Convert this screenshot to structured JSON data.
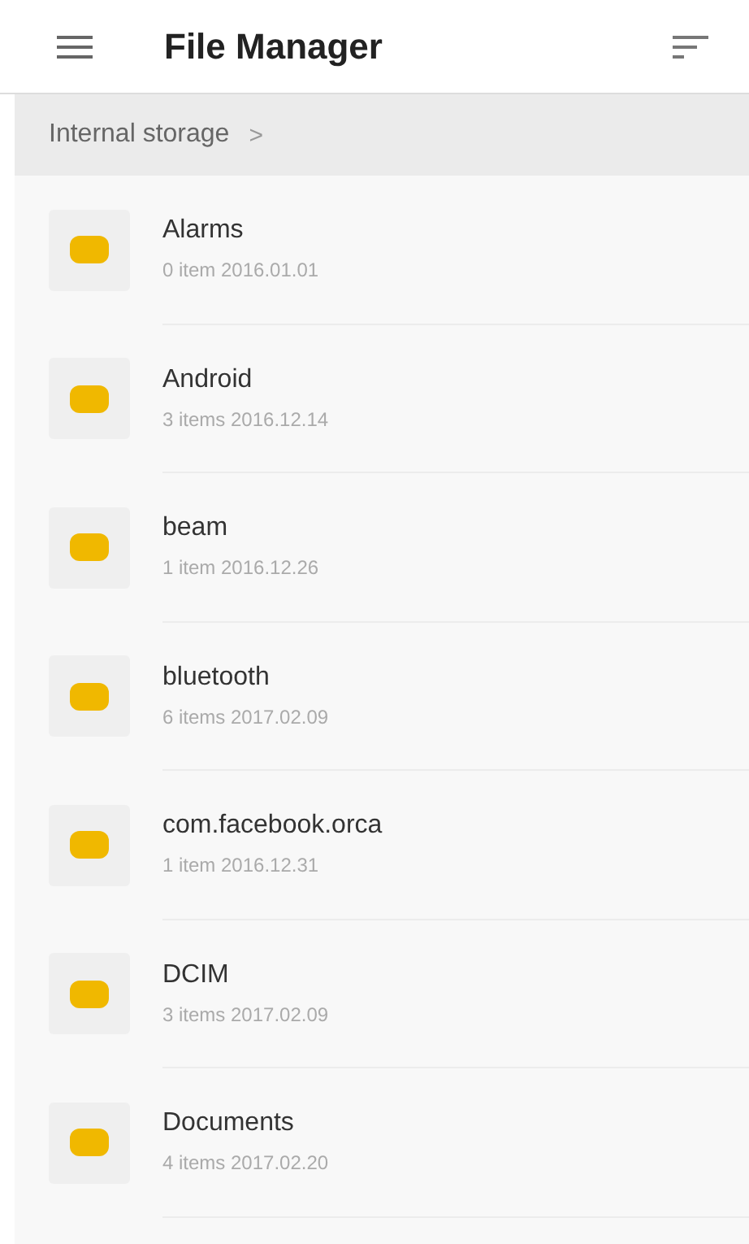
{
  "app_bar": {
    "title": "File Manager"
  },
  "breadcrumb": {
    "path": "Internal storage",
    "separator": ">"
  },
  "folders": [
    {
      "name": "Alarms",
      "details": "0 item  2016.01.01"
    },
    {
      "name": "Android",
      "details": "3 items  2016.12.14"
    },
    {
      "name": "beam",
      "details": "1 item  2016.12.26"
    },
    {
      "name": "bluetooth",
      "details": "6 items  2017.02.09"
    },
    {
      "name": "com.facebook.orca",
      "details": "1 item  2016.12.31"
    },
    {
      "name": "DCIM",
      "details": "3 items  2017.02.09"
    },
    {
      "name": "Documents",
      "details": "4 items  2017.02.20"
    }
  ]
}
